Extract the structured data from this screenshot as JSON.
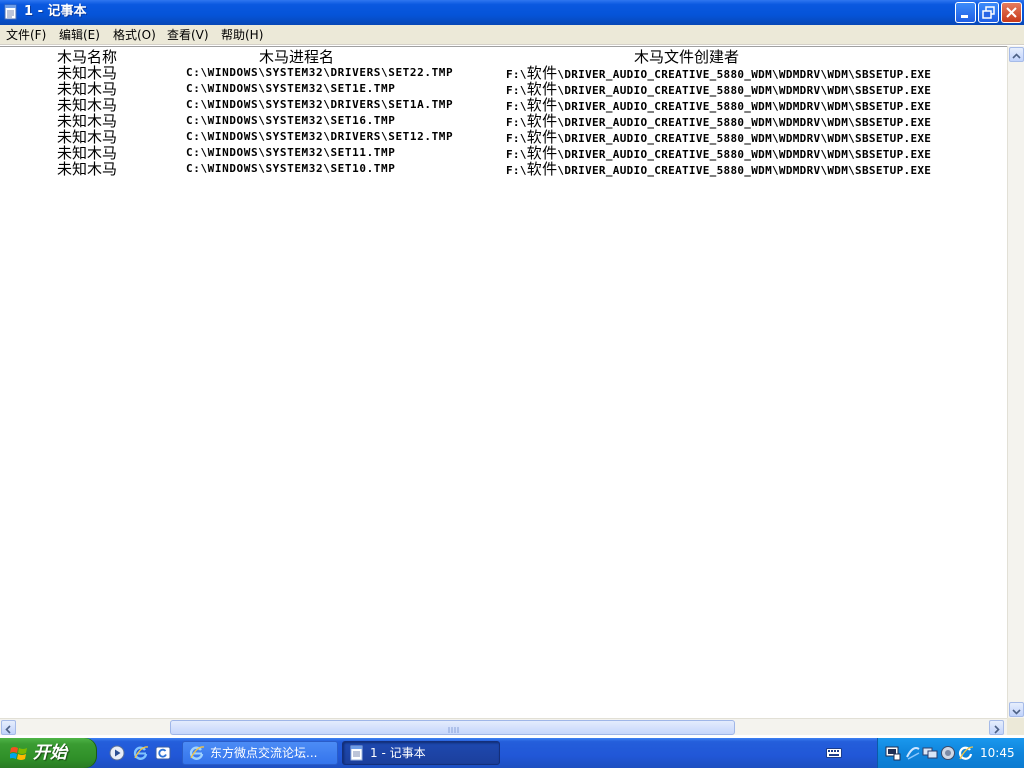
{
  "window": {
    "title": "1 - 记事本"
  },
  "menu": [
    "文件(F)",
    "编辑(E)",
    "格式(O)",
    "查看(V)",
    "帮助(H)"
  ],
  "document": {
    "headers": [
      "木马名称",
      "木马进程名",
      "木马文件创建者"
    ],
    "rows": [
      {
        "name": "未知木马",
        "process": "C:\\WINDOWS\\SYSTEM32\\DRIVERS\\SET22.TMP",
        "drive": "F:\\",
        "folder": "软件",
        "creator_rest": "\\DRIVER_AUDIO_CREATIVE_5880_WDM\\WDMDRV\\WDM\\SBSETUP.EXE"
      },
      {
        "name": "未知木马",
        "process": "C:\\WINDOWS\\SYSTEM32\\SET1E.TMP",
        "drive": "F:\\",
        "folder": "软件",
        "creator_rest": "\\DRIVER_AUDIO_CREATIVE_5880_WDM\\WDMDRV\\WDM\\SBSETUP.EXE"
      },
      {
        "name": "未知木马",
        "process": "C:\\WINDOWS\\SYSTEM32\\DRIVERS\\SET1A.TMP",
        "drive": "F:\\",
        "folder": "软件",
        "creator_rest": "\\DRIVER_AUDIO_CREATIVE_5880_WDM\\WDMDRV\\WDM\\SBSETUP.EXE"
      },
      {
        "name": "未知木马",
        "process": "C:\\WINDOWS\\SYSTEM32\\SET16.TMP",
        "drive": "F:\\",
        "folder": "软件",
        "creator_rest": "\\DRIVER_AUDIO_CREATIVE_5880_WDM\\WDMDRV\\WDM\\SBSETUP.EXE"
      },
      {
        "name": "未知木马",
        "process": "C:\\WINDOWS\\SYSTEM32\\DRIVERS\\SET12.TMP",
        "drive": "F:\\",
        "folder": "软件",
        "creator_rest": "\\DRIVER_AUDIO_CREATIVE_5880_WDM\\WDMDRV\\WDM\\SBSETUP.EXE"
      },
      {
        "name": "未知木马",
        "process": "C:\\WINDOWS\\SYSTEM32\\SET11.TMP",
        "drive": "F:\\",
        "folder": "软件",
        "creator_rest": "\\DRIVER_AUDIO_CREATIVE_5880_WDM\\WDMDRV\\WDM\\SBSETUP.EXE"
      },
      {
        "name": "未知木马",
        "process": "C:\\WINDOWS\\SYSTEM32\\SET10.TMP",
        "drive": "F:\\",
        "folder": "软件",
        "creator_rest": "\\DRIVER_AUDIO_CREATIVE_5880_WDM\\WDMDRV\\WDM\\SBSETUP.EXE"
      }
    ]
  },
  "taskbar": {
    "start_label": "开始",
    "quick_launch": [
      "media-player-icon",
      "ie-icon",
      "ie-alt-icon"
    ],
    "tasks": [
      {
        "icon": "ie-icon",
        "label": "东方微点交流论坛...",
        "active": false
      },
      {
        "icon": "notepad-icon",
        "label": "1 - 记事本",
        "active": true
      }
    ],
    "tray_icons": [
      "network-icon",
      "sync-icon",
      "monitor-icon",
      "volume-icon",
      "update-icon"
    ],
    "clock": "10:45"
  },
  "colors": {
    "titlebar": "#0554d8",
    "menubar": "#ece9d8",
    "taskbar": "#245edb",
    "start": "#3a9c32",
    "tray": "#0f85dc",
    "text": "#000000",
    "page": "#ffffff"
  }
}
